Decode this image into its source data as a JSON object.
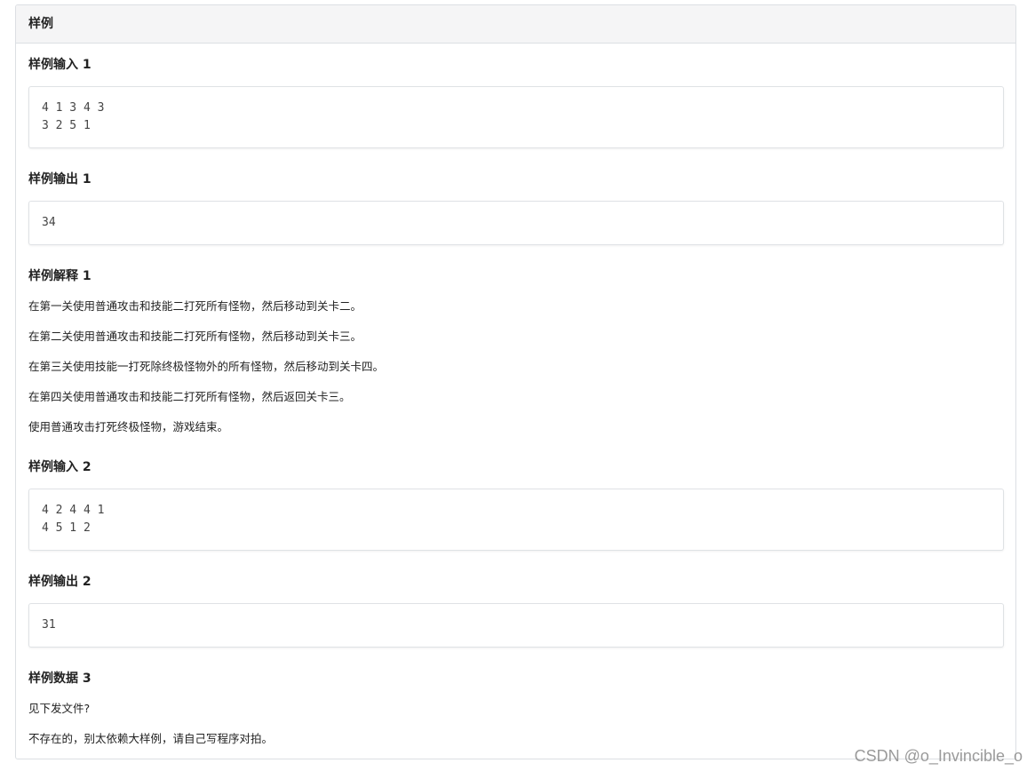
{
  "panel": {
    "title": "样例"
  },
  "samples": {
    "input1_title": "样例输入 1",
    "input1_content": "4 1 3 4 3\n3 2 5 1",
    "output1_title": "样例输出 1",
    "output1_content": "34",
    "explain1_title": "样例解释 1",
    "explain1_lines": [
      "在第一关使用普通攻击和技能二打死所有怪物，然后移动到关卡二。",
      "在第二关使用普通攻击和技能二打死所有怪物，然后移动到关卡三。",
      "在第三关使用技能一打死除终极怪物外的所有怪物，然后移动到关卡四。",
      "在第四关使用普通攻击和技能二打死所有怪物，然后返回关卡三。",
      "使用普通攻击打死终极怪物，游戏结束。"
    ],
    "input2_title": "样例输入 2",
    "input2_content": "4 2 4 4 1\n4 5 1 2",
    "output2_title": "样例输出 2",
    "output2_content": "31",
    "data3_title": "样例数据 3",
    "data3_lines": [
      "见下发文件?",
      "不存在的，别太依赖大样例，请自己写程序对拍。"
    ]
  },
  "watermark": "CSDN @o_Invincible_o"
}
